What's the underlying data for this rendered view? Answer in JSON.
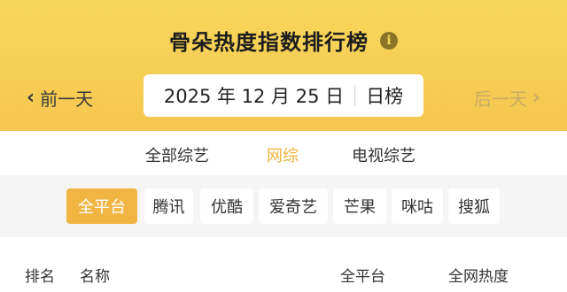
{
  "header": {
    "title": "骨朵热度指数排行榜",
    "info_icon": "info-icon",
    "info_glyph": "i",
    "prev_label": "前一天",
    "next_label": "后一天",
    "date_text": "2025 年 12 月 25 日",
    "period_label": "日榜"
  },
  "tabs": [
    {
      "label": "全部综艺",
      "active": false
    },
    {
      "label": "网综",
      "active": true
    },
    {
      "label": "电视综艺",
      "active": false
    }
  ],
  "platforms": [
    {
      "label": "全平台",
      "active": true
    },
    {
      "label": "腾讯",
      "active": false
    },
    {
      "label": "优酷",
      "active": false
    },
    {
      "label": "爱奇艺",
      "active": false
    },
    {
      "label": "芒果",
      "active": false
    },
    {
      "label": "咪咕",
      "active": false
    },
    {
      "label": "搜狐",
      "active": false
    }
  ],
  "table": {
    "columns": [
      "排名",
      "名称",
      "全平台",
      "全网热度"
    ]
  },
  "colors": {
    "accent": "#f1b544",
    "header_bg": "#f6cd55",
    "chip_bg": "#ffffff",
    "strip_bg": "#f5f5f5"
  }
}
